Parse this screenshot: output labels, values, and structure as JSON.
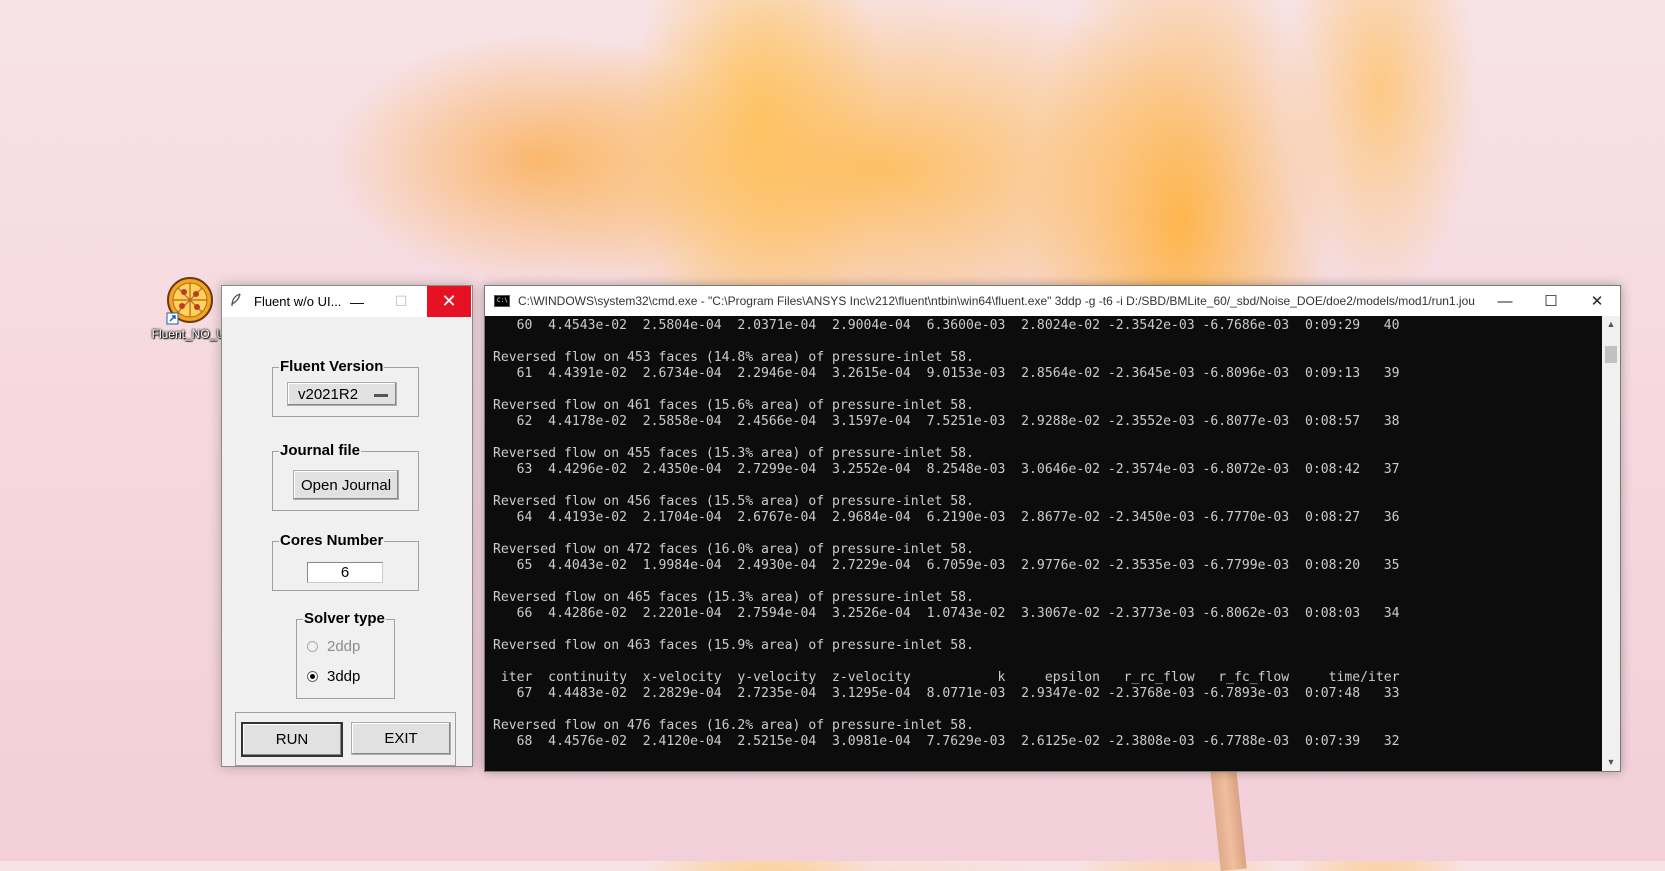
{
  "desktop": {
    "shortcut_label": "Fluent_NO_UI"
  },
  "launcher": {
    "title": "Fluent w/o UI...",
    "fluent_version": {
      "label": "Fluent Version",
      "selected": "v2021R2"
    },
    "journal": {
      "label": "Journal file",
      "button": "Open Journal"
    },
    "cores": {
      "label": "Cores Number",
      "value": "6"
    },
    "solver": {
      "label": "Solver type",
      "options": [
        "2ddp",
        "3ddp"
      ],
      "selected": "3ddp"
    },
    "run_label": "RUN",
    "exit_label": "EXIT"
  },
  "console": {
    "title": "C:\\WINDOWS\\system32\\cmd.exe - \"C:\\Program Files\\ANSYS Inc\\v212\\fluent\\ntbin\\win64\\fluent.exe\"  3ddp -g -t6 -i D:/SBD/BMLite_60/_sbd/Noise_DOE/doe2/models/mod1/run1.jou",
    "lines": [
      "   60  4.4543e-02  2.5804e-04  2.0371e-04  2.9004e-04  6.3600e-03  2.8024e-02 -2.3542e-03 -6.7686e-03  0:09:29   40",
      "",
      "Reversed flow on 453 faces (14.8% area) of pressure-inlet 58.",
      "   61  4.4391e-02  2.6734e-04  2.2946e-04  3.2615e-04  9.0153e-03  2.8564e-02 -2.3645e-03 -6.8096e-03  0:09:13   39",
      "",
      "Reversed flow on 461 faces (15.6% area) of pressure-inlet 58.",
      "   62  4.4178e-02  2.5858e-04  2.4566e-04  3.1597e-04  7.5251e-03  2.9288e-02 -2.3552e-03 -6.8077e-03  0:08:57   38",
      "",
      "Reversed flow on 455 faces (15.3% area) of pressure-inlet 58.",
      "   63  4.4296e-02  2.4350e-04  2.7299e-04  3.2552e-04  8.2548e-03  3.0646e-02 -2.3574e-03 -6.8072e-03  0:08:42   37",
      "",
      "Reversed flow on 456 faces (15.5% area) of pressure-inlet 58.",
      "   64  4.4193e-02  2.1704e-04  2.6767e-04  2.9684e-04  6.2190e-03  2.8677e-02 -2.3450e-03 -6.7770e-03  0:08:27   36",
      "",
      "Reversed flow on 472 faces (16.0% area) of pressure-inlet 58.",
      "   65  4.4043e-02  1.9984e-04  2.4930e-04  2.7229e-04  6.7059e-03  2.9776e-02 -2.3535e-03 -6.7799e-03  0:08:20   35",
      "",
      "Reversed flow on 465 faces (15.3% area) of pressure-inlet 58.",
      "   66  4.4286e-02  2.2201e-04  2.7594e-04  3.2526e-04  1.0743e-02  3.3067e-02 -2.3773e-03 -6.8062e-03  0:08:03   34",
      "",
      "Reversed flow on 463 faces (15.9% area) of pressure-inlet 58.",
      "",
      " iter  continuity  x-velocity  y-velocity  z-velocity           k     epsilon   r_rc_flow   r_fc_flow     time/iter",
      "   67  4.4483e-02  2.2829e-04  2.7235e-04  3.1295e-04  8.0771e-03  2.9347e-02 -2.3768e-03 -6.7893e-03  0:07:48   33",
      "",
      "Reversed flow on 476 faces (16.2% area) of pressure-inlet 58.",
      "   68  4.4576e-02  2.4120e-04  2.5215e-04  3.0981e-04  7.7629e-03  2.6125e-02 -2.3808e-03 -6.7788e-03  0:07:39   32"
    ]
  }
}
